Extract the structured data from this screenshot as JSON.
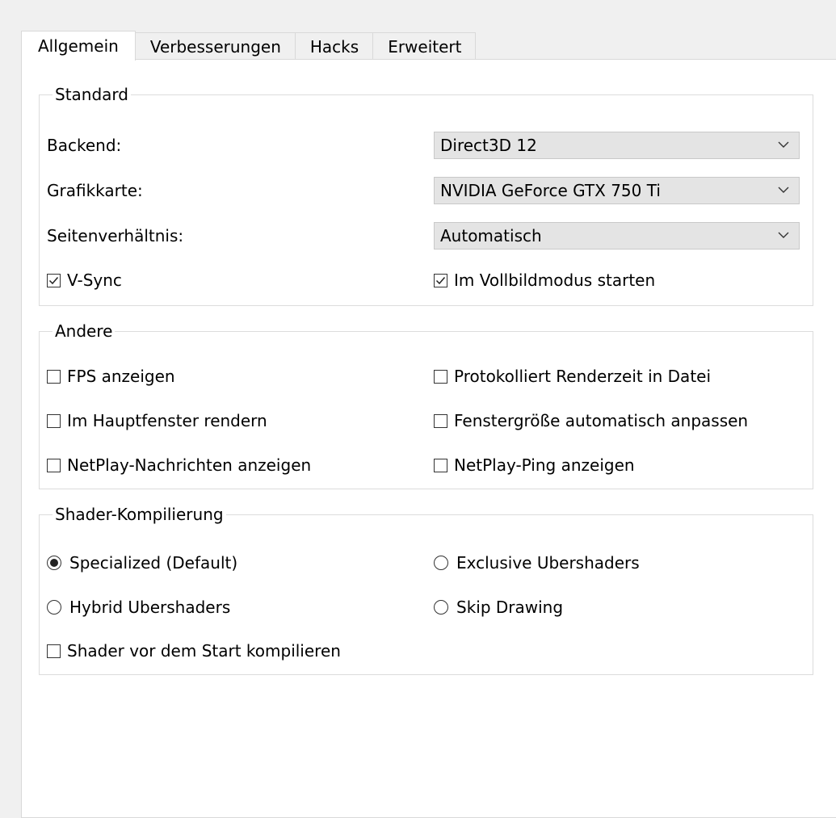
{
  "tabs": [
    {
      "label": "Allgemein",
      "active": true
    },
    {
      "label": "Verbesserungen",
      "active": false
    },
    {
      "label": "Hacks",
      "active": false
    },
    {
      "label": "Erweitert",
      "active": false
    }
  ],
  "standard": {
    "title": "Standard",
    "backend_label": "Backend:",
    "backend_value": "Direct3D 12",
    "gpu_label": "Grafikkarte:",
    "gpu_value": "NVIDIA GeForce GTX 750 Ti",
    "aspect_label": "Seitenverhältnis:",
    "aspect_value": "Automatisch",
    "vsync_label": "V-Sync",
    "vsync_checked": true,
    "fullscreen_label": "Im Vollbildmodus starten",
    "fullscreen_checked": true
  },
  "other": {
    "title": "Andere",
    "show_fps": {
      "label": "FPS anzeigen",
      "checked": false
    },
    "log_render_time": {
      "label": "Protokolliert Renderzeit in Datei",
      "checked": false
    },
    "render_main_window": {
      "label": "Im Hauptfenster rendern",
      "checked": false
    },
    "auto_window_size": {
      "label": "Fenstergröße automatisch anpassen",
      "checked": false
    },
    "netplay_messages": {
      "label": "NetPlay-Nachrichten anzeigen",
      "checked": false
    },
    "netplay_ping": {
      "label": "NetPlay-Ping anzeigen",
      "checked": false
    }
  },
  "shader": {
    "title": "Shader-Kompilierung",
    "specialized": {
      "label": "Specialized (Default)",
      "selected": true
    },
    "exclusive_ubershaders": {
      "label": "Exclusive Ubershaders",
      "selected": false
    },
    "hybrid_ubershaders": {
      "label": "Hybrid Ubershaders",
      "selected": false
    },
    "skip_drawing": {
      "label": "Skip Drawing",
      "selected": false
    },
    "precompile": {
      "label": "Shader vor dem Start kompilieren",
      "checked": false
    }
  },
  "icons": {
    "dropdown": "chevron-down-icon",
    "checked": "checkmark-icon",
    "radio_selected": "radio-dot-icon"
  },
  "colors": {
    "background": "#f0f0f0",
    "panel": "#ffffff",
    "select_bg": "#e4e4e4",
    "border": "#d9d9d9"
  }
}
